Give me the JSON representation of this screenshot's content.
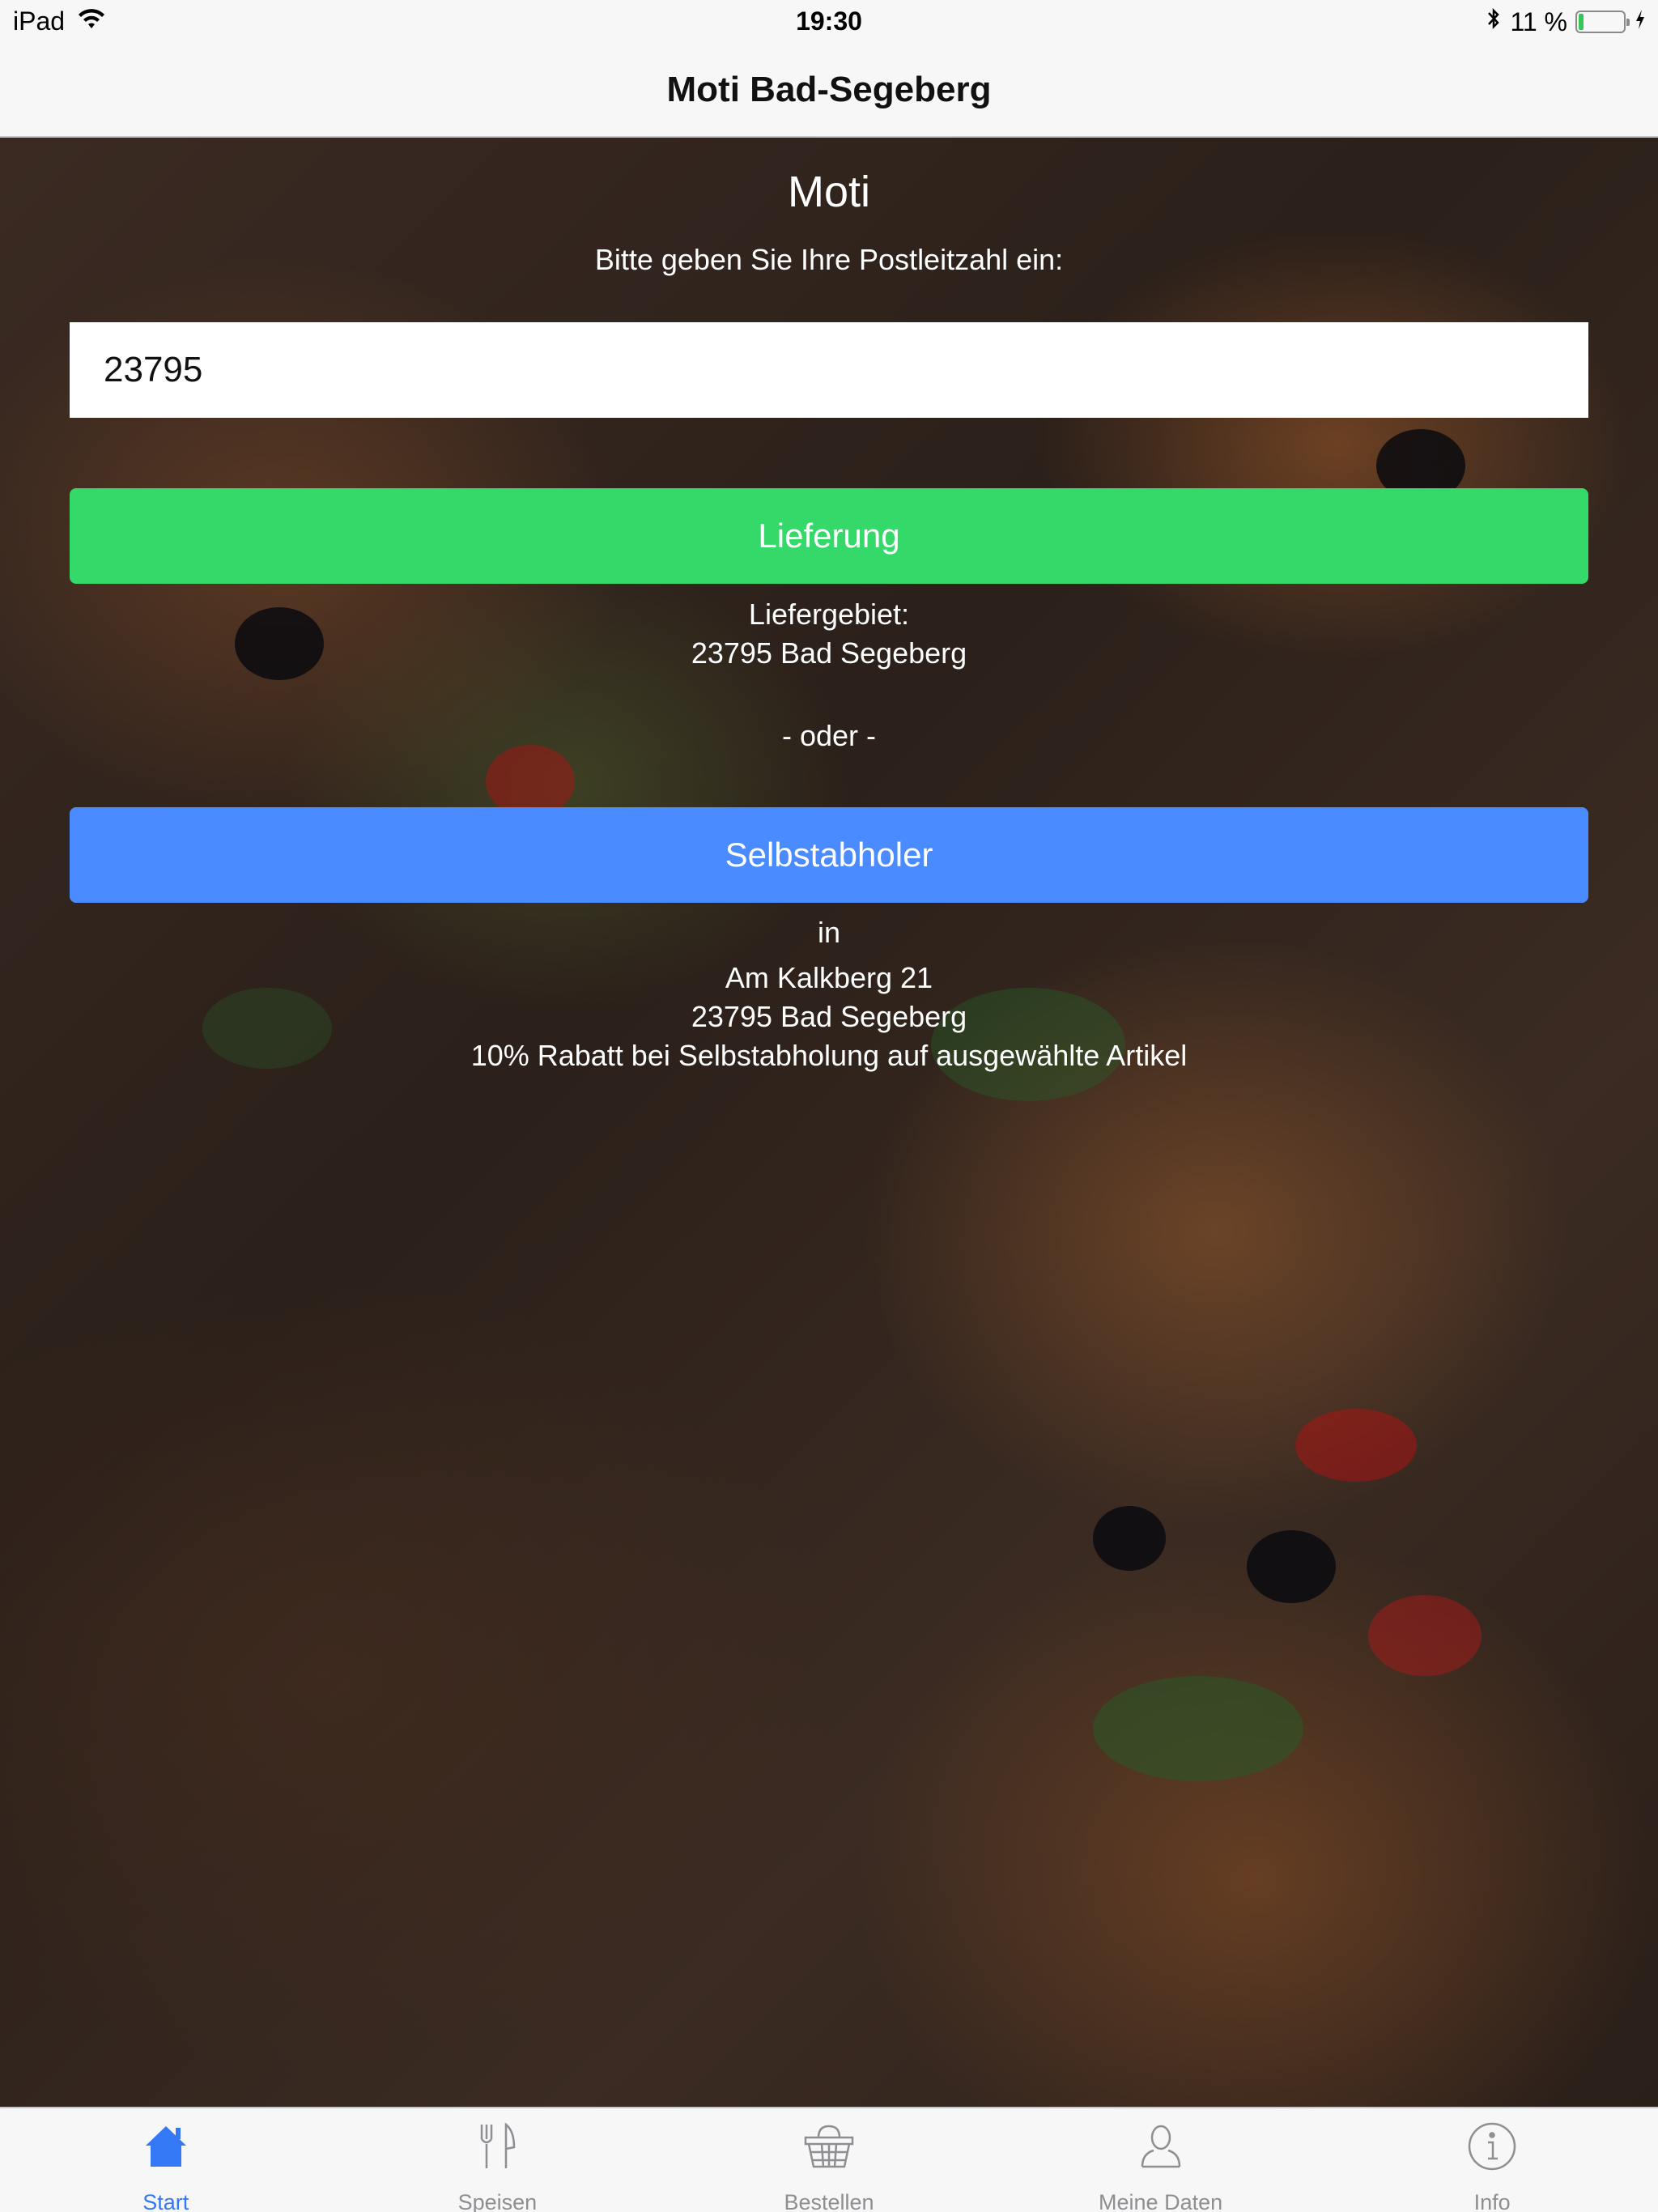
{
  "status_bar": {
    "device": "iPad",
    "time": "19:30",
    "battery_percent": "11 %",
    "battery_level": 0.11,
    "icons": [
      "wifi-icon",
      "bluetooth-icon",
      "battery-icon",
      "charging-icon"
    ]
  },
  "nav": {
    "title": "Moti Bad-Segeberg"
  },
  "main": {
    "brand": "Moti",
    "prompt": "Bitte geben Sie Ihre Postleitzahl ein:",
    "zip_value": "23795",
    "delivery_button": "Lieferung",
    "delivery_area_label": "Liefergebiet:",
    "delivery_area_value": "23795 Bad Segeberg",
    "or_separator": "- oder -",
    "pickup_button": "Selbstabholer",
    "pickup_in": "in",
    "pickup_street": "Am Kalkberg 21",
    "pickup_city": "23795 Bad Segeberg",
    "pickup_discount": "10% Rabatt bei Selbstabholung auf ausgewählte Artikel"
  },
  "tabs": [
    {
      "label": "Start",
      "icon": "home-icon",
      "active": true
    },
    {
      "label": "Speisen",
      "icon": "fork-knife-icon",
      "active": false
    },
    {
      "label": "Bestellen",
      "icon": "basket-icon",
      "active": false
    },
    {
      "label": "Meine Daten",
      "icon": "person-icon",
      "active": false
    },
    {
      "label": "Info",
      "icon": "info-icon",
      "active": false
    }
  ],
  "colors": {
    "delivery_button": "#35d96a",
    "pickup_button": "#4a8bff",
    "tab_active": "#3478f6",
    "tab_inactive": "#8e8e93"
  }
}
